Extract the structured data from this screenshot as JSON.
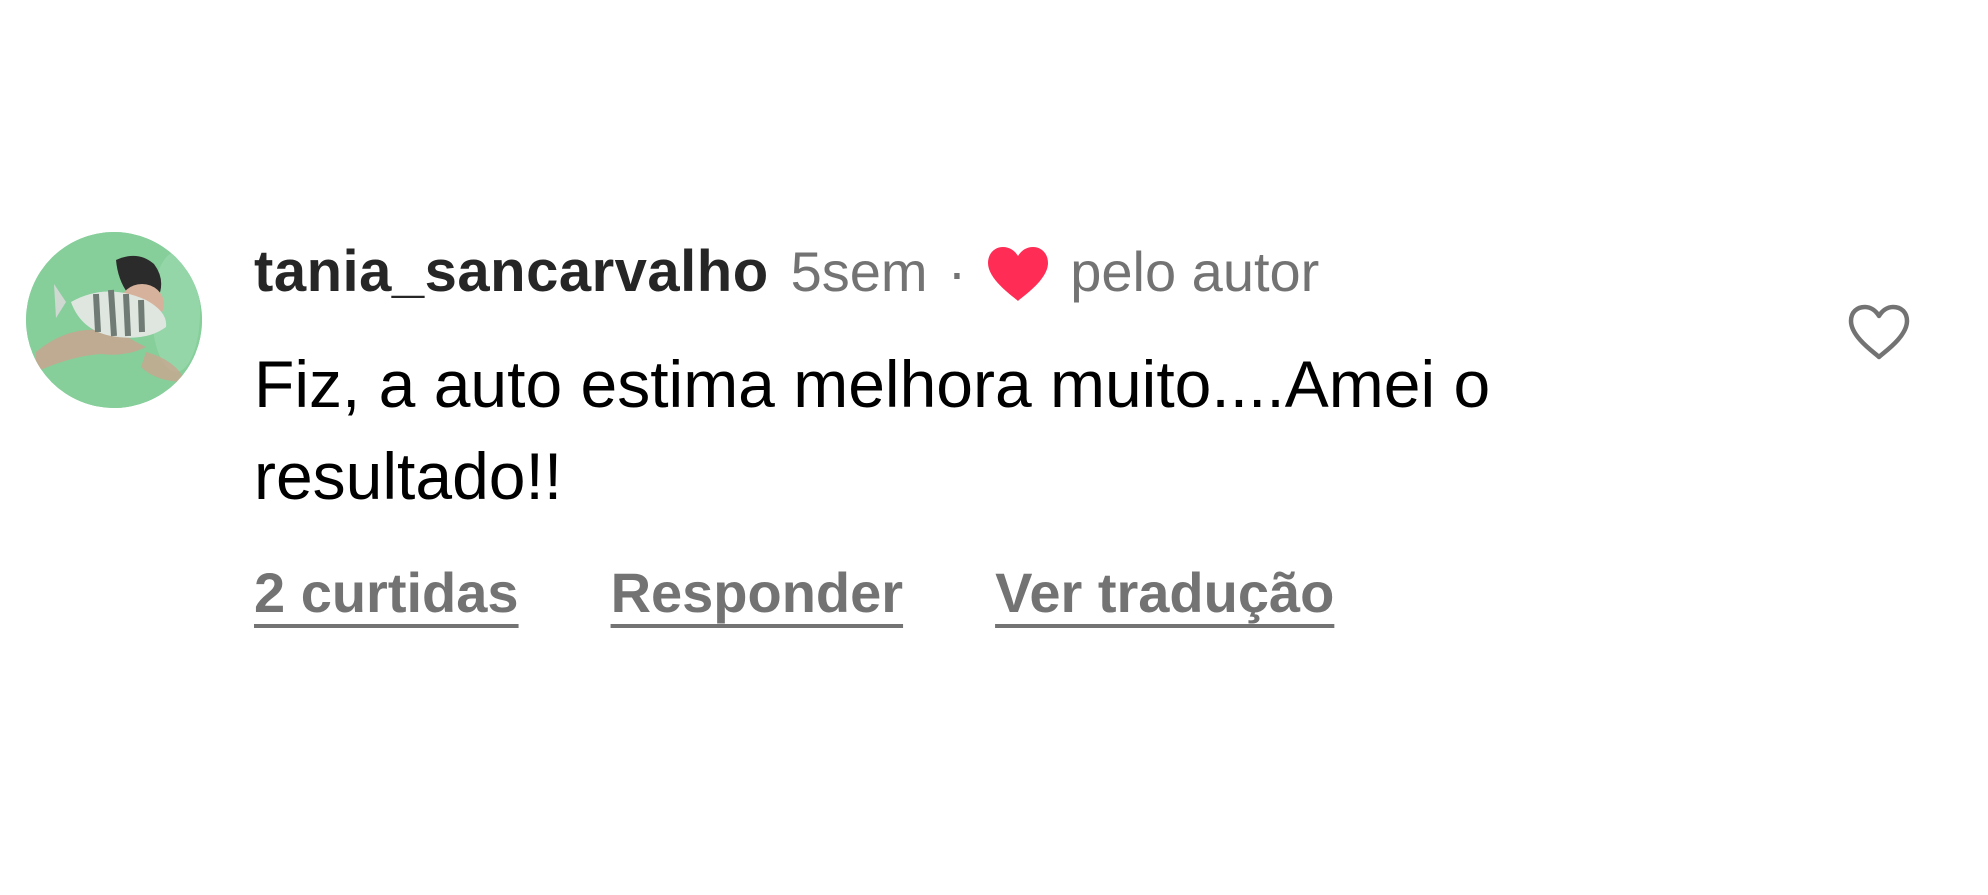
{
  "comment": {
    "username": "tania_sancarvalho",
    "time": "5sem",
    "separator": "·",
    "author_liked_label": "pelo autor",
    "text": "Fiz, a auto estima melhora muito....Amei o resultado!!",
    "actions": {
      "likes_label": "2 curtidas",
      "reply_label": "Responder",
      "translate_label": "Ver tradução"
    },
    "icons": {
      "author_heart": "filled-heart-icon",
      "like": "heart-outline-icon"
    },
    "colors": {
      "heart_red": "#ff2d55",
      "secondary_text": "#737373",
      "username": "#262626"
    }
  }
}
